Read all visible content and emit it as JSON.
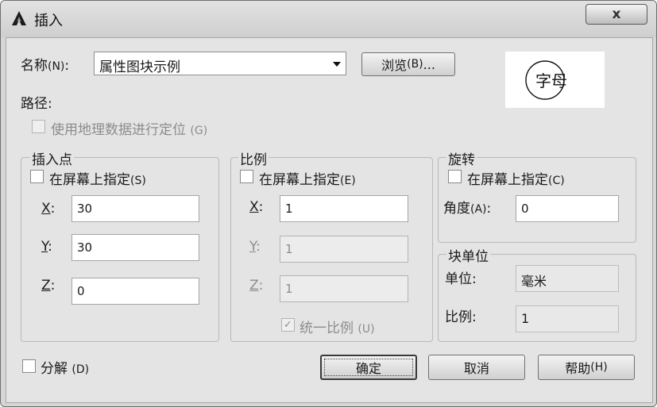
{
  "window": {
    "title": "插入",
    "close_glyph": "x"
  },
  "name_row": {
    "label": "名称",
    "mnemonic": "(N)",
    "colon": ":",
    "selected": "属性图块示例"
  },
  "browse": {
    "label": "浏览",
    "mnemonic": "(B)",
    "ellipsis": "..."
  },
  "preview": {
    "text": "字母"
  },
  "path": {
    "label": "路径:"
  },
  "geo": {
    "label": "使用地理数据进行定位",
    "mnemonic": "(G)",
    "checked": false,
    "enabled": false
  },
  "insertion_point": {
    "title": "插入点",
    "specify": {
      "label": "在屏幕上指定",
      "mnemonic": "(S)",
      "checked": false
    },
    "x": {
      "label": "X",
      "value": "30"
    },
    "y": {
      "label": "Y",
      "value": "30"
    },
    "z": {
      "label": "Z",
      "value": "0"
    }
  },
  "scale": {
    "title": "比例",
    "specify": {
      "label": "在屏幕上指定",
      "mnemonic": "(E)",
      "checked": false
    },
    "x": {
      "label": "X",
      "value": "1"
    },
    "y": {
      "label": "Y",
      "value": "1"
    },
    "z": {
      "label": "Z",
      "value": "1"
    },
    "uniform": {
      "label": "统一比例",
      "mnemonic": "(U)",
      "checked": true,
      "enabled": false
    }
  },
  "rotation": {
    "title": "旋转",
    "specify": {
      "label": "在屏幕上指定",
      "mnemonic": "(C)",
      "checked": false
    },
    "angle": {
      "label": "角度",
      "mnemonic": "(A)",
      "colon": ":",
      "value": "0"
    }
  },
  "block_unit": {
    "title": "块单位",
    "unit": {
      "label": "单位:",
      "value": "毫米"
    },
    "factor": {
      "label": "比例:",
      "value": "1"
    }
  },
  "explode": {
    "label": "分解",
    "mnemonic": "(D)",
    "checked": false
  },
  "buttons": {
    "ok": {
      "label": "确定"
    },
    "cancel": {
      "label": "取消"
    },
    "help": {
      "label": "帮助",
      "mnemonic": "(H)"
    }
  },
  "colors": {
    "window_bg": "#d6d6d6",
    "panel_bg": "#e4e4e4",
    "disabled_text": "#8c8c8c"
  }
}
